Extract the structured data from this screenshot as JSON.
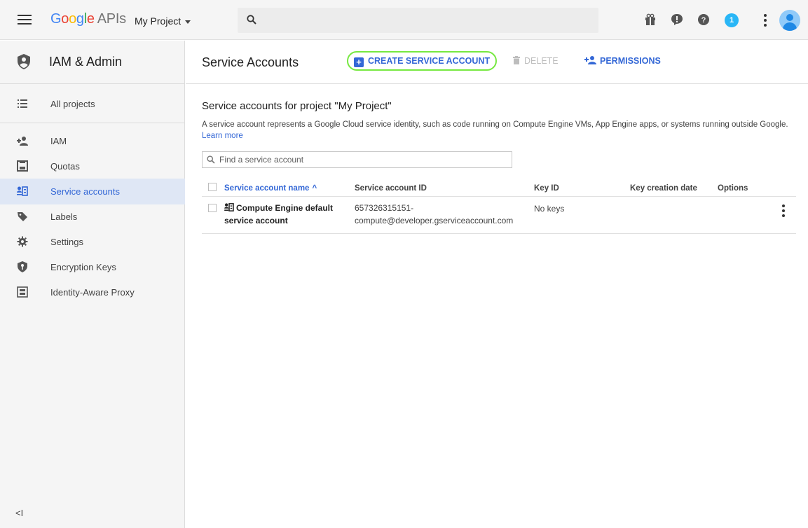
{
  "topbar": {
    "brand_letters": [
      "G",
      "o",
      "o",
      "g",
      "l",
      "e"
    ],
    "brand_suffix": "APIs",
    "project_name": "My Project",
    "search_placeholder": "",
    "notification_count": "1"
  },
  "sidebar": {
    "title": "IAM & Admin",
    "items": [
      {
        "label": "All projects",
        "icon": "list-icon"
      },
      {
        "label": "IAM",
        "icon": "person-add-icon"
      },
      {
        "label": "Quotas",
        "icon": "quota-icon"
      },
      {
        "label": "Service accounts",
        "icon": "service-account-icon"
      },
      {
        "label": "Labels",
        "icon": "label-icon"
      },
      {
        "label": "Settings",
        "icon": "gear-icon"
      },
      {
        "label": "Encryption Keys",
        "icon": "key-shield-icon"
      },
      {
        "label": "Identity-Aware Proxy",
        "icon": "proxy-icon"
      }
    ],
    "collapse_label": "<I",
    "active_item": "Service accounts"
  },
  "header": {
    "title": "Service Accounts",
    "create_label": "CREATE SERVICE ACCOUNT",
    "delete_label": "DELETE",
    "permissions_label": "PERMISSIONS"
  },
  "main": {
    "section_title": "Service accounts for project \"My Project\"",
    "description": "A service account represents a Google Cloud service identity, such as code running on Compute Engine VMs, App Engine apps, or systems running outside Google.",
    "learn_more": "Learn more",
    "search_placeholder": "Find a service account",
    "table": {
      "columns": [
        "Service account name",
        "Service account ID",
        "Key ID",
        "Key creation date",
        "Options"
      ],
      "sort_indicator": "^",
      "rows": [
        {
          "name_line1": "Compute Engine default",
          "name_line2": "service account",
          "id_line1": "657326315151-",
          "id_line2": "compute@developer.gserviceaccount.com",
          "key_id": "No keys",
          "key_date": ""
        }
      ]
    }
  },
  "colors": {
    "accent": "#3367d6",
    "highlight_border": "#76e840",
    "active_bg": "#dfe7f5",
    "sidebar_bg": "#f5f5f5"
  }
}
